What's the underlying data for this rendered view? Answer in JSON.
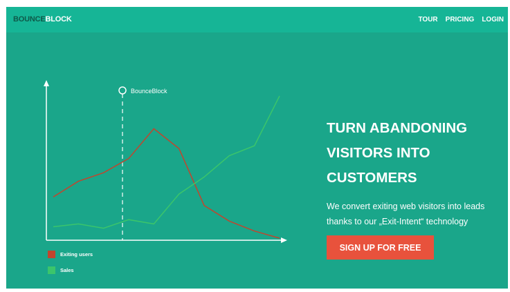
{
  "header": {
    "logo_part1": "BOUNCE",
    "logo_part2": "BLOCK",
    "nav": [
      "TOUR",
      "PRICING",
      "LOGIN"
    ]
  },
  "hero": {
    "headline_lines": [
      "TURN ABANDONING",
      "VISITORS INTO",
      "CUSTOMERS"
    ],
    "subtext_lines": [
      "We convert exiting web visitors into leads",
      "thanks to our „Exit-Intent“ technology"
    ],
    "cta_label": "SIGN UP FOR FREE"
  },
  "chart_data": {
    "type": "line",
    "marker_label": "BounceBlock",
    "series": [
      {
        "name": "Exiting users",
        "color": "#c2452d",
        "values": [
          0.29,
          0.4,
          0.46,
          0.56,
          0.77,
          0.63,
          0.23,
          0.12,
          0.05,
          0.0
        ]
      },
      {
        "name": "Sales",
        "color": "#3bc56b",
        "values": [
          0.08,
          0.1,
          0.07,
          0.13,
          0.1,
          0.31,
          0.43,
          0.58,
          0.65,
          1.0
        ]
      }
    ]
  },
  "colors": {
    "background": "#1aa68a",
    "topbar": "#16b596",
    "cta": "#e8523c"
  }
}
